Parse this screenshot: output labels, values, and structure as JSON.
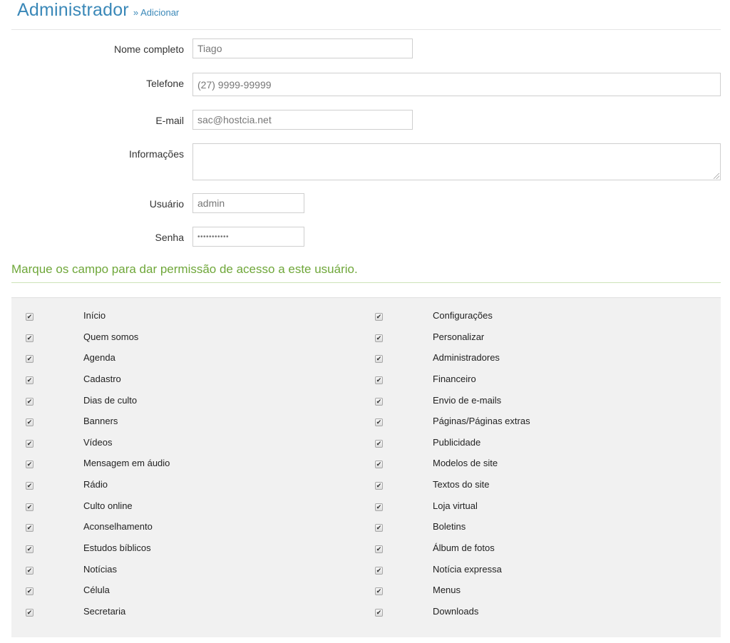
{
  "header": {
    "title": "Administrador",
    "separator": "»",
    "subtitle": "Adicionar"
  },
  "form": {
    "nome": {
      "label": "Nome completo",
      "value": "Tiago"
    },
    "telefone": {
      "label": "Telefone",
      "value": "(27) 9999-99999"
    },
    "email": {
      "label": "E-mail",
      "value": "sac@hostcia.net"
    },
    "informacoes": {
      "label": "Informações",
      "value": ""
    },
    "usuario": {
      "label": "Usuário",
      "value": "admin"
    },
    "senha": {
      "label": "Senha",
      "value": "•••••••••••"
    }
  },
  "permissions": {
    "title": "Marque os campo para dar permissão de acesso a este usuário.",
    "left": [
      {
        "label": "Início",
        "checked": true
      },
      {
        "label": "Quem somos",
        "checked": true
      },
      {
        "label": "Agenda",
        "checked": true
      },
      {
        "label": "Cadastro",
        "checked": true
      },
      {
        "label": "Dias de culto",
        "checked": true
      },
      {
        "label": "Banners",
        "checked": true
      },
      {
        "label": "Vídeos",
        "checked": true
      },
      {
        "label": "Mensagem em áudio",
        "checked": true
      },
      {
        "label": "Rádio",
        "checked": true
      },
      {
        "label": "Culto online",
        "checked": true
      },
      {
        "label": "Aconselhamento",
        "checked": true
      },
      {
        "label": "Estudos bíblicos",
        "checked": true
      },
      {
        "label": "Notícias",
        "checked": true
      },
      {
        "label": "Célula",
        "checked": true
      },
      {
        "label": "Secretaria",
        "checked": true
      }
    ],
    "right": [
      {
        "label": "Configurações",
        "checked": true
      },
      {
        "label": "Personalizar",
        "checked": true
      },
      {
        "label": "Administradores",
        "checked": true
      },
      {
        "label": "Financeiro",
        "checked": true
      },
      {
        "label": "Envio de e-mails",
        "checked": true
      },
      {
        "label": "Páginas/Páginas extras",
        "checked": true
      },
      {
        "label": "Publicidade",
        "checked": true
      },
      {
        "label": "Modelos de site",
        "checked": true
      },
      {
        "label": "Textos do site",
        "checked": true
      },
      {
        "label": "Loja virtual",
        "checked": true
      },
      {
        "label": "Boletins",
        "checked": true
      },
      {
        "label": "Álbum de fotos",
        "checked": true
      },
      {
        "label": "Notícia expressa",
        "checked": true
      },
      {
        "label": "Menus",
        "checked": true
      },
      {
        "label": "Downloads",
        "checked": true
      }
    ]
  }
}
